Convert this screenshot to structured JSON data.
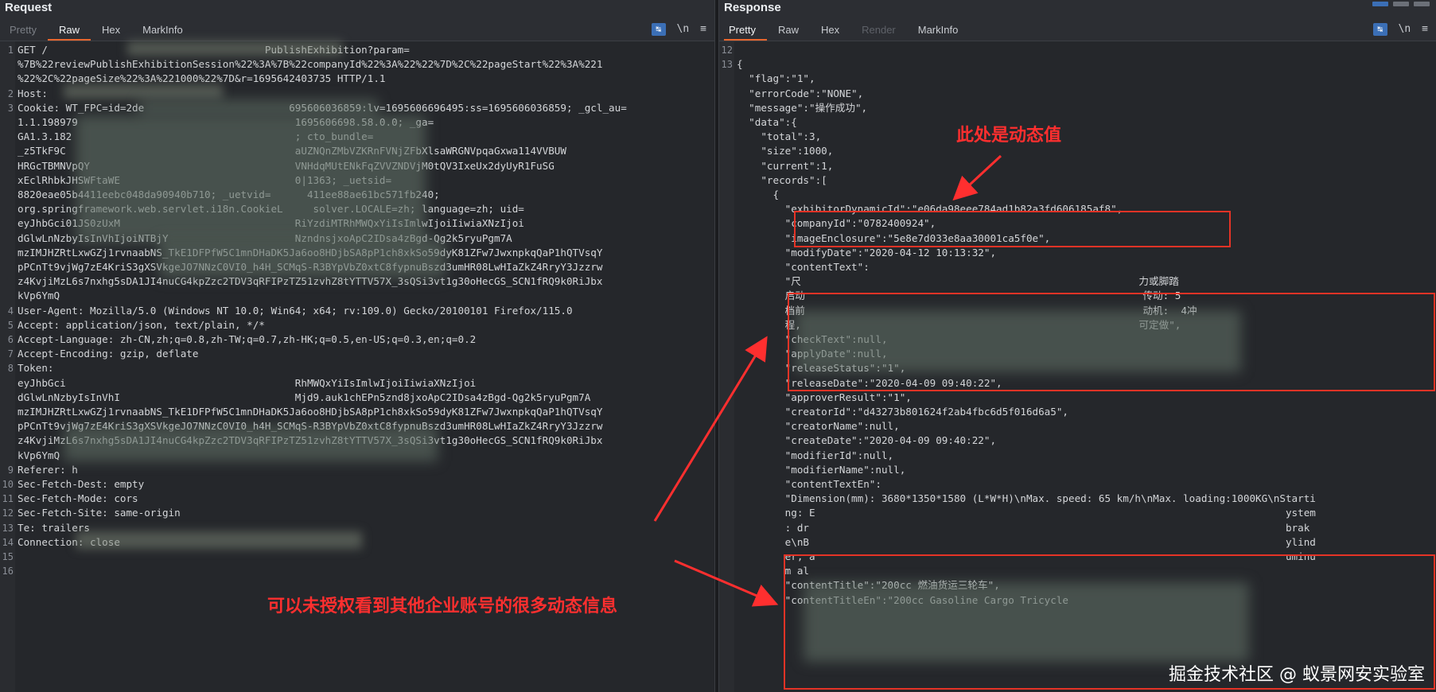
{
  "request": {
    "title": "Request",
    "tabs": [
      "Pretty",
      "Raw",
      "Hex",
      "MarkInfo"
    ],
    "tools": {
      "newline": "\\n",
      "menu": "≡"
    },
    "lines": [
      {
        "n": "1",
        "t": "GET /                                    PublishExhibition?param="
      },
      {
        "n": "",
        "t": "%7B%22reviewPublishExhibitionSession%22%3A%7B%22companyId%22%3A%22%22%7D%2C%22pageStart%22%3A%221"
      },
      {
        "n": "",
        "t": "%22%2C%22pageSize%22%3A%221000%22%7D&r=1695642403735 HTTP/1.1"
      },
      {
        "n": "2",
        "t": "Host:"
      },
      {
        "n": "3",
        "t": "Cookie: WT_FPC=id=2de                        695606036859:lv=1695606696495:ss=1695606036859; _gcl_au="
      },
      {
        "n": "",
        "t": "1.1.198979                                    1695606698.58.0.0; _ga="
      },
      {
        "n": "",
        "t": "GA1.3.182                                     ; cto_bundle="
      },
      {
        "n": "",
        "t": "_z5TkF9C                                      aUZNQnZMbVZKRnFVNjZFbXlsaWRGNVpqaGxwa114VVBUW"
      },
      {
        "n": "",
        "t": "HRGcTBMNVpQY                                  VNHdqMUtENkFqZVVZNDVjM0tQV3IxeUx2dyUyR1FuSG"
      },
      {
        "n": "",
        "t": "xEclRhbkJHSWFtaWE                             0|1363; _uetsid="
      },
      {
        "n": "",
        "t": "8820eae05b4411eebc048da90940b710; _uetvid=      411ee88ae61bc571fb240;"
      },
      {
        "n": "",
        "t": "org.springframework.web.servlet.i18n.CookieL     solver.LOCALE=zh; language=zh; uid="
      },
      {
        "n": "",
        "t": "eyJhbGci01JS0zUxM                             RiYzdiMTRhMWQxYiIsImlwIjoiIiwiaXNzIjoi"
      },
      {
        "n": "",
        "t": "dGlwLnNzbyIsInVhIjoiNTBjY                     NzndnsjxoApC2IDsa4zBgd-Qg2k5ryuPgm7A"
      },
      {
        "n": "",
        "t": "mzIMJHZRtLxwGZj1rvnaabNS_TkE1DFPfW5C1mnDHaDK5Ja6oo8HDjbSA8pP1ch8xkSo59dyK81ZFw7JwxnpkqQaP1hQTVsqY"
      },
      {
        "n": "",
        "t": "pPCnTt9vjWg7zE4KriS3gXSVkgeJO7NNzC0VI0_h4H_SCMqS-R3BYpVbZ0xtC8fypnuBszd3umHR08LwHIaZkZ4RryY3Jzzrw"
      },
      {
        "n": "",
        "t": "z4KvjiMzL6s7nxhg5sDA1JI4nuCG4kpZzc2TDV3qRFIPzTZ51zvhZ8tYTTV57X_3sQSi3vt1g30oHecGS_SCN1fRQ9k0RiJbx"
      },
      {
        "n": "",
        "t": "kVp6YmQ"
      },
      {
        "n": "4",
        "t": "User-Agent: Mozilla/5.0 (Windows NT 10.0; Win64; x64; rv:109.0) Gecko/20100101 Firefox/115.0"
      },
      {
        "n": "5",
        "t": "Accept: application/json, text/plain, */*"
      },
      {
        "n": "6",
        "t": "Accept-Language: zh-CN,zh;q=0.8,zh-TW;q=0.7,zh-HK;q=0.5,en-US;q=0.3,en;q=0.2"
      },
      {
        "n": "7",
        "t": "Accept-Encoding: gzip, deflate"
      },
      {
        "n": "8",
        "t": "Token:"
      },
      {
        "n": "",
        "t": "eyJhbGci                                      RhMWQxYiIsImlwIjoiIiwiaXNzIjoi"
      },
      {
        "n": "",
        "t": "dGlwLnNzbyIsInVhI                             Mjd9.auk1chEPn5znd8jxoApC2IDsa4zBgd-Qg2k5ryuPgm7A"
      },
      {
        "n": "",
        "t": "mzIMJHZRtLxwGZj1rvnaabNS_TkE1DFPfW5C1mnDHaDK5Ja6oo8HDjbSA8pP1ch8xkSo59dyK81ZFw7JwxnpkqQaP1hQTVsqY"
      },
      {
        "n": "",
        "t": "pPCnTt9vjWg7zE4KriS3gXSVkgeJO7NNzC0VI0_h4H_SCMqS-R3BYpVbZ0xtC8fypnuBszd3umHR08LwHIaZkZ4RryY3Jzzrw"
      },
      {
        "n": "",
        "t": "z4KvjiMzL6s7nxhg5sDA1JI4nuCG4kpZzc2TDV3qRFIPzTZ51zvhZ8tYTTV57X_3sQSi3vt1g30oHecGS_SCN1fRQ9k0RiJbx"
      },
      {
        "n": "",
        "t": "kVp6YmQ"
      },
      {
        "n": "9",
        "t": "Referer: h"
      },
      {
        "n": "10",
        "t": "Sec-Fetch-Dest: empty"
      },
      {
        "n": "11",
        "t": "Sec-Fetch-Mode: cors"
      },
      {
        "n": "12",
        "t": "Sec-Fetch-Site: same-origin"
      },
      {
        "n": "13",
        "t": "Te: trailers"
      },
      {
        "n": "14",
        "t": "Connection: close"
      },
      {
        "n": "15",
        "t": ""
      },
      {
        "n": "16",
        "t": ""
      }
    ]
  },
  "response": {
    "title": "Response",
    "tabs": [
      "Pretty",
      "Raw",
      "Hex",
      "Render",
      "MarkInfo"
    ],
    "tools": {
      "newline": "\\n",
      "menu": "≡"
    },
    "lines": [
      {
        "n": "12",
        "t": ""
      },
      {
        "n": "13",
        "t": "{"
      },
      {
        "n": "",
        "t": "  \"flag\":\"1\","
      },
      {
        "n": "",
        "t": "  \"errorCode\":\"NONE\","
      },
      {
        "n": "",
        "t": "  \"message\":\"操作成功\","
      },
      {
        "n": "",
        "t": "  \"data\":{"
      },
      {
        "n": "",
        "t": "    \"total\":3,"
      },
      {
        "n": "",
        "t": "    \"size\":1000,"
      },
      {
        "n": "",
        "t": "    \"current\":1,"
      },
      {
        "n": "",
        "t": "    \"records\":["
      },
      {
        "n": "",
        "t": "      {"
      },
      {
        "n": "",
        "t": "        \"exhibitorDynamicId\":\"e06da98eee784ad1b82a3fd606185af8\","
      },
      {
        "n": "",
        "t": "        \"companyId\":\"0782400924\","
      },
      {
        "n": "",
        "t": "        \"imageEnclosure\":\"5e8e7d033e8aa30001ca5f0e\","
      },
      {
        "n": "",
        "t": "        \"modifyDate\":\"2020-04-12 10:13:32\","
      },
      {
        "n": "",
        "t": "        \"contentText\":"
      },
      {
        "n": "",
        "t": "        \"尺                                                        力或脚踏"
      },
      {
        "n": "",
        "t": "        启动                                                        传动: 5"
      },
      {
        "n": "",
        "t": "        档前                                                        动机:  4冲"
      },
      {
        "n": "",
        "t": "        程,                                                        可定做\","
      },
      {
        "n": "",
        "t": "        \"checkText\":null,"
      },
      {
        "n": "",
        "t": "        \"applyDate\":null,"
      },
      {
        "n": "",
        "t": "        \"releaseStatus\":\"1\","
      },
      {
        "n": "",
        "t": "        \"releaseDate\":\"2020-04-09 09:40:22\","
      },
      {
        "n": "",
        "t": "        \"approverResult\":\"1\","
      },
      {
        "n": "",
        "t": "        \"creatorId\":\"d43273b801624f2ab4fbc6d5f016d6a5\","
      },
      {
        "n": "",
        "t": "        \"creatorName\":null,"
      },
      {
        "n": "",
        "t": "        \"createDate\":\"2020-04-09 09:40:22\","
      },
      {
        "n": "",
        "t": "        \"modifierId\":null,"
      },
      {
        "n": "",
        "t": "        \"modifierName\":null,"
      },
      {
        "n": "",
        "t": "        \"contentTextEn\":"
      },
      {
        "n": "",
        "t": "        \"Dimension(mm): 3680*1350*1580 (L*W*H)\\nMax. speed: 65 km/h\\nMax. loading:1000KG\\nStarti"
      },
      {
        "n": "",
        "t": "        ng: E                                                                              ystem"
      },
      {
        "n": "",
        "t": "        : dr                                                                               brak"
      },
      {
        "n": "",
        "t": "        e\\nB                                                                               ylind"
      },
      {
        "n": "",
        "t": "        er, a                                                                              uminu"
      },
      {
        "n": "",
        "t": "        m al"
      },
      {
        "n": "",
        "t": "        \"contentTitle\":\"200cc 燃油货运三轮车\","
      },
      {
        "n": "",
        "t": "        \"contentTitleEn\":\"200cc Gasoline Cargo Tricycle"
      }
    ]
  },
  "annotations": {
    "dynamic_value": "此处是动态值",
    "unauthorized": "可以未授权看到其他企业账号的很多动态信息"
  },
  "watermark": "掘金技术社区 @ 蚁景网安实验室",
  "colors": {
    "accent": "#e8672e",
    "annotation": "#ff2f2f",
    "button": "#3b6fb6"
  }
}
